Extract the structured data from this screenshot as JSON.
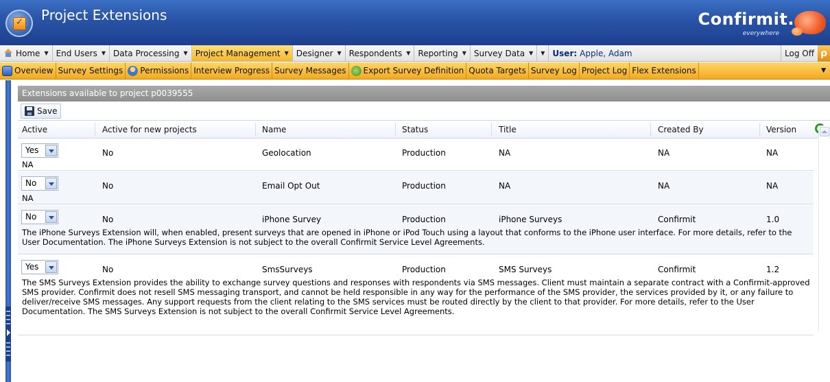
{
  "app": {
    "title": "Project Extensions",
    "brand": "Confirmit.",
    "brand_tagline": "everywhere"
  },
  "menu": {
    "items": [
      {
        "label": "Home",
        "active": false
      },
      {
        "label": "End Users",
        "active": false
      },
      {
        "label": "Data Processing",
        "active": false
      },
      {
        "label": "Project Management",
        "active": true
      },
      {
        "label": "Designer",
        "active": false
      },
      {
        "label": "Respondents",
        "active": false
      },
      {
        "label": "Reporting",
        "active": false
      },
      {
        "label": "Survey Data",
        "active": false
      },
      {
        "label": "",
        "active": false
      }
    ],
    "user_label": "User:",
    "user_name": "Apple, Adam",
    "logoff": "Log Off"
  },
  "submenu": {
    "items": [
      {
        "label": "Overview",
        "icon": "overview-icon"
      },
      {
        "label": "Survey Settings",
        "icon": ""
      },
      {
        "label": "Permissions",
        "icon": "permissions-icon"
      },
      {
        "label": "Interview Progress",
        "icon": ""
      },
      {
        "label": "Survey Messages",
        "icon": ""
      },
      {
        "label": "Export Survey Definition",
        "icon": "export-icon"
      },
      {
        "label": "Quota Targets",
        "icon": ""
      },
      {
        "label": "Survey Log",
        "icon": ""
      },
      {
        "label": "Project Log",
        "icon": ""
      },
      {
        "label": "Flex Extensions",
        "icon": ""
      }
    ]
  },
  "panel": {
    "header": "Extensions available to project p0039555",
    "save_label": "Save"
  },
  "grid": {
    "columns": {
      "active": "Active",
      "active_new": "Active for new projects",
      "name": "Name",
      "status": "Status",
      "title": "Title",
      "created_by": "Created By",
      "version": "Version"
    },
    "rows": [
      {
        "active": "Yes",
        "active_new": "No",
        "name": "Geolocation",
        "status": "Production",
        "title": "NA",
        "created_by": "NA",
        "version": "NA",
        "description": "NA"
      },
      {
        "active": "No",
        "active_new": "No",
        "name": "Email Opt Out",
        "status": "Production",
        "title": "NA",
        "created_by": "NA",
        "version": "NA",
        "description": "NA"
      },
      {
        "active": "No",
        "active_new": "No",
        "name": "iPhone Survey",
        "status": "Production",
        "title": "iPhone Surveys",
        "created_by": "Confirmit",
        "version": "1.0",
        "description": "The iPhone Surveys Extension will, when enabled, present surveys that are opened in iPhone or iPod Touch using a layout that conforms to the iPhone user interface. For more details, refer to the User Documentation. The iPhone Surveys Extension is not subject to the overall Confirmit Service Level Agreements."
      },
      {
        "active": "Yes",
        "active_new": "No",
        "name": "SmsSurveys",
        "status": "Production",
        "title": "SMS Surveys",
        "created_by": "Confirmit",
        "version": "1.2",
        "description": "The SMS Surveys Extension provides the ability to exchange survey questions and responses with respondents via SMS messages. Client must maintain a separate contract with a Confirmit-approved SMS provider. Confirmit does not resell SMS messaging transport, and cannot be held responsible in any way for the performance of the SMS provider, the services provided by it, or any failure to deliver/receive SMS messages. Any support requests from the client relating to the SMS services must be routed directly by the client to that provider. For more details, refer to the User Documentation. The SMS Surveys Extension is not subject to the overall Confirmit Service Level Agreements."
      }
    ]
  }
}
